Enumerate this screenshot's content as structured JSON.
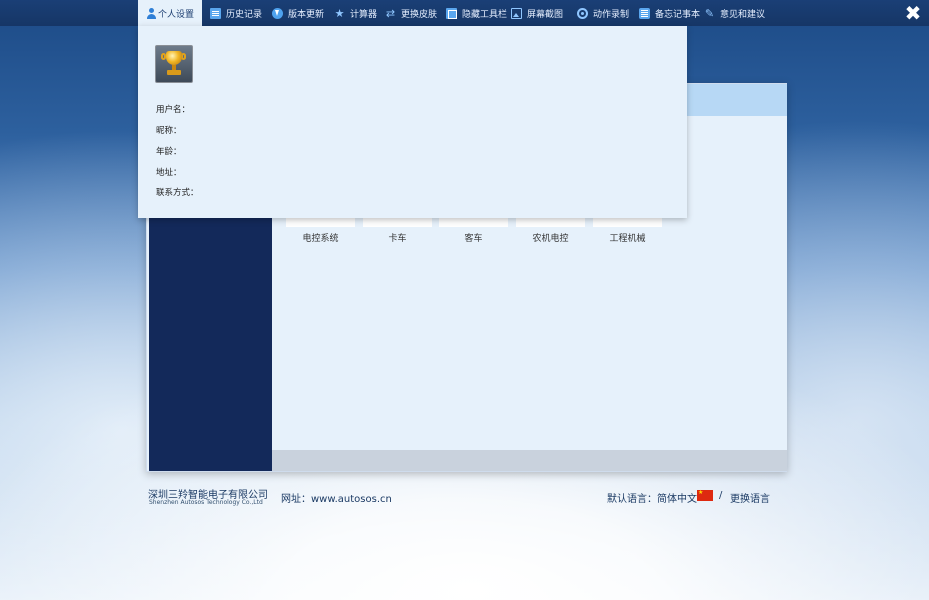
{
  "toolbar": {
    "items": [
      {
        "label": "个人设置",
        "icon": "person-icon"
      },
      {
        "label": "历史记录",
        "icon": "document-icon"
      },
      {
        "label": "版本更新",
        "icon": "update-icon"
      },
      {
        "label": "计算器",
        "icon": "star-icon"
      },
      {
        "label": "更换皮肤",
        "icon": "swap-icon"
      },
      {
        "label": "隐藏工具栏",
        "icon": "toolbar-icon"
      },
      {
        "label": "屏幕截图",
        "icon": "image-icon"
      },
      {
        "label": "动作录制",
        "icon": "record-icon"
      },
      {
        "label": "备忘记事本",
        "icon": "notepad-icon"
      },
      {
        "label": "意见和建议",
        "icon": "pencil-icon"
      }
    ],
    "close_symbol": "✖"
  },
  "profile": {
    "avatar": "trophy-icon",
    "fields": {
      "username_label": "用户名：",
      "nickname_label": "昵称：",
      "age_label": "年龄：",
      "address_label": "地址：",
      "contact_label": "联系方式："
    }
  },
  "categories": [
    "电控系统",
    "卡车",
    "客车",
    "农机电控",
    "工程机械"
  ],
  "footer": {
    "company_cn": "深圳三羚智能电子有限公司",
    "company_en": "Shenzhen Autosos Technology Co.,Ltd",
    "website": "网址：www.autosos.cn",
    "default_language": "默认语言：简体中文",
    "separator": "/",
    "change_language": "更换语言"
  },
  "colors": {
    "toolbar": "#163666",
    "panel": "#e6f1fb",
    "sidebar": "#13295a",
    "header_strip": "#b7d8f5"
  }
}
